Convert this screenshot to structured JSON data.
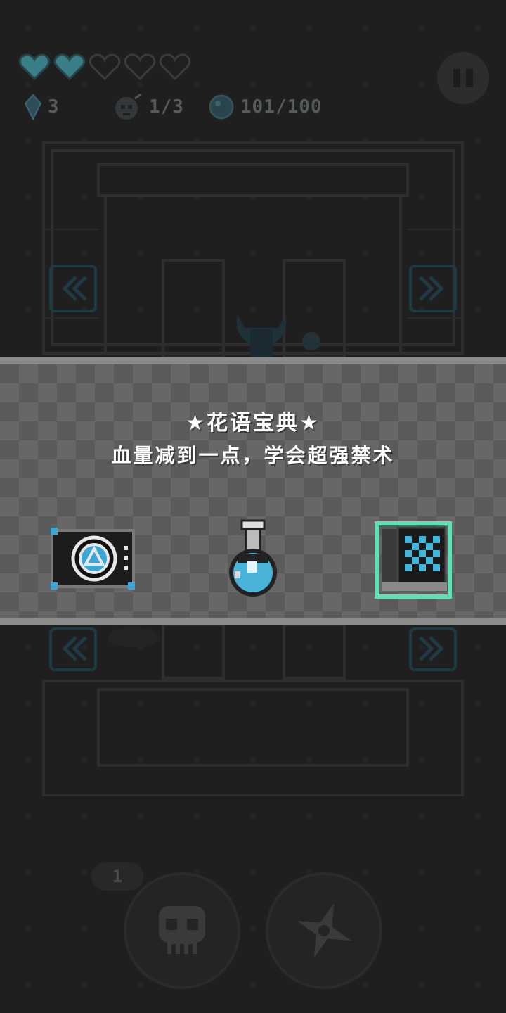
{
  "hud": {
    "hearts": [
      {
        "state": "full",
        "icon": "heart-full-icon"
      },
      {
        "state": "full",
        "icon": "heart-full-icon"
      },
      {
        "state": "empty",
        "icon": "heart-empty-icon"
      },
      {
        "state": "empty",
        "icon": "heart-empty-icon"
      },
      {
        "state": "empty",
        "icon": "heart-empty-icon"
      }
    ],
    "gems": "3",
    "kills": "1/3",
    "energy": "101/100"
  },
  "banner": {
    "title": "★花语宝典★",
    "description": "血量减到一点，学会超强禁术"
  },
  "rewards": [
    {
      "icon": "tech-card-icon",
      "selected": false
    },
    {
      "icon": "potion-flask-icon",
      "selected": false
    },
    {
      "icon": "spell-book-icon",
      "selected": true
    }
  ],
  "controls": {
    "level_badge": "1"
  },
  "colors": {
    "accent": "#5fe0b8",
    "heart_fill": "#3a7f88",
    "banner_bg": "#5b5b5b",
    "banner_border": "#8b8b8b"
  }
}
